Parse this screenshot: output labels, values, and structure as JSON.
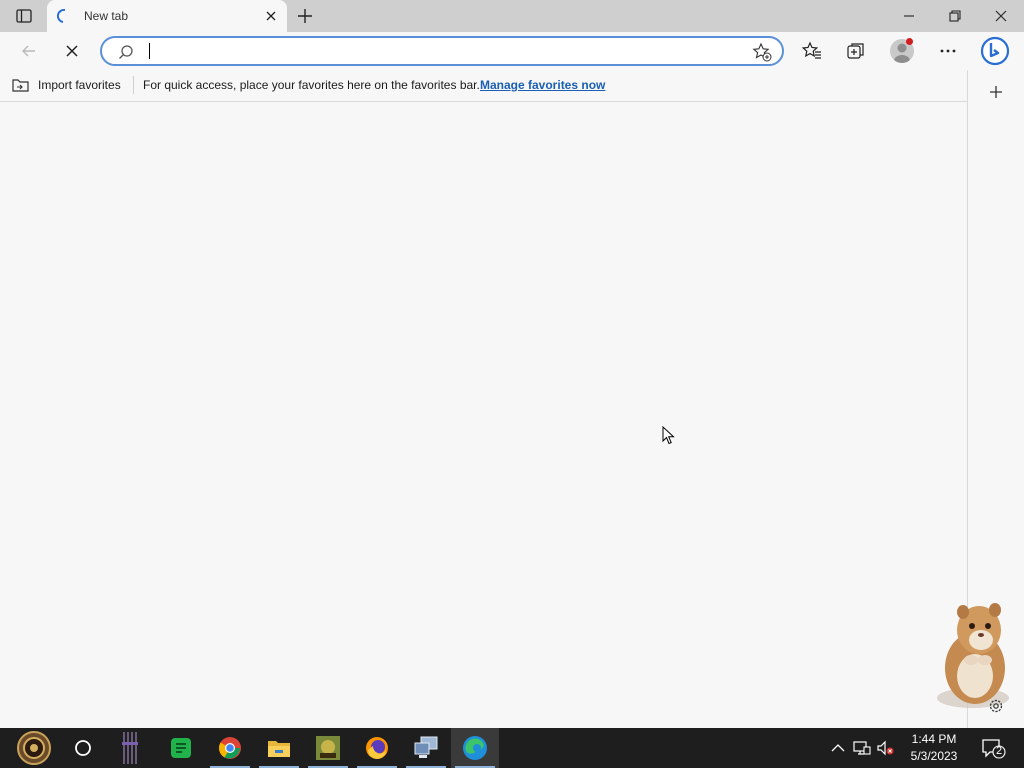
{
  "browser": {
    "tab": {
      "title": "New tab"
    },
    "address_bar": {
      "value": "",
      "placeholder": ""
    },
    "favorites_bar": {
      "import_label": "Import favorites",
      "message": "For quick access, place your favorites here on the favorites bar.",
      "manage_link": "Manage favorites now"
    }
  },
  "taskbar": {
    "apps": [
      "steampunk-start-icon",
      "cortana-icon",
      "striped-app-icon",
      "green-chat-app-icon",
      "chrome-icon",
      "file-explorer-icon",
      "game-app-icon",
      "firefox-icon",
      "network-computer-icon",
      "edge-icon"
    ],
    "clock": {
      "time": "1:44 PM",
      "date": "5/3/2023"
    },
    "notification_count": "2"
  },
  "colors": {
    "accent": "#1a5fb4",
    "address_border": "#5b8fd7",
    "taskbar": "#1e1e1e"
  }
}
